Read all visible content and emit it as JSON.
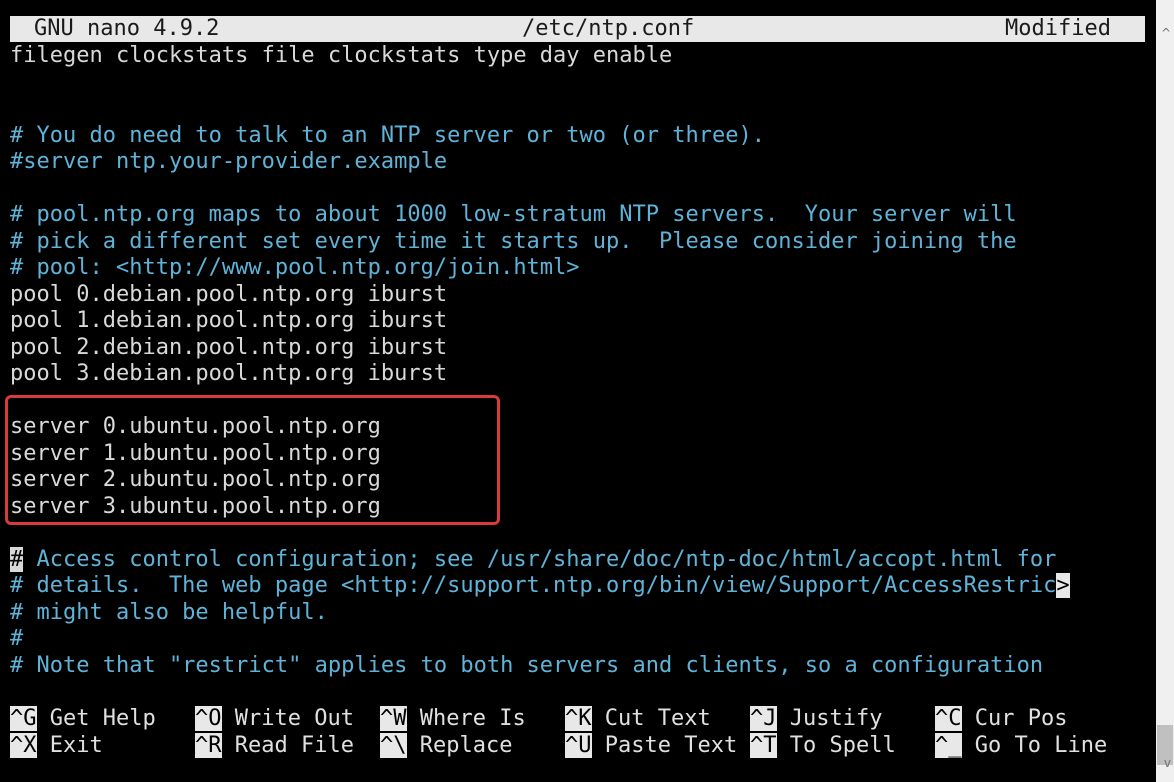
{
  "titlebar": {
    "app": "GNU nano 4.9.2",
    "file": "/etc/ntp.conf",
    "status": "Modified"
  },
  "lines": [
    {
      "text": "filegen clockstats file clockstats type day enable",
      "kind": "plain"
    },
    {
      "text": "",
      "kind": "plain"
    },
    {
      "text": "",
      "kind": "plain"
    },
    {
      "text": "# You do need to talk to an NTP server or two (or three).",
      "kind": "comment"
    },
    {
      "text": "#server ntp.your-provider.example",
      "kind": "comment"
    },
    {
      "text": "",
      "kind": "plain"
    },
    {
      "text": "# pool.ntp.org maps to about 1000 low-stratum NTP servers.  Your server will",
      "kind": "comment"
    },
    {
      "text": "# pick a different set every time it starts up.  Please consider joining the",
      "kind": "comment"
    },
    {
      "text": "# pool: <http://www.pool.ntp.org/join.html>",
      "kind": "comment"
    },
    {
      "text": "pool 0.debian.pool.ntp.org iburst",
      "kind": "plain"
    },
    {
      "text": "pool 1.debian.pool.ntp.org iburst",
      "kind": "plain"
    },
    {
      "text": "pool 2.debian.pool.ntp.org iburst",
      "kind": "plain"
    },
    {
      "text": "pool 3.debian.pool.ntp.org iburst",
      "kind": "plain"
    },
    {
      "text": "",
      "kind": "plain"
    },
    {
      "text": "server 0.ubuntu.pool.ntp.org",
      "kind": "plain"
    },
    {
      "text": "server 1.ubuntu.pool.ntp.org",
      "kind": "plain"
    },
    {
      "text": "server 2.ubuntu.pool.ntp.org",
      "kind": "plain"
    },
    {
      "text": "server 3.ubuntu.pool.ntp.org",
      "kind": "plain"
    },
    {
      "text": "",
      "kind": "plain"
    },
    {
      "text": " Access control configuration; see /usr/share/doc/ntp-doc/html/accopt.html for",
      "kind": "comment"
    },
    {
      "text": "# details.  The web page <http://support.ntp.org/bin/view/Support/AccessRestric",
      "kind": "comment"
    },
    {
      "text": "# might also be helpful.",
      "kind": "comment"
    },
    {
      "text": "#",
      "kind": "comment"
    },
    {
      "text": "# Note that \"restrict\" applies to both servers and clients, so a configuration",
      "kind": "comment"
    }
  ],
  "cursor_char": "#",
  "overflow_char": ">",
  "shortcuts_row1": [
    {
      "key": "^G",
      "label": "Get Help"
    },
    {
      "key": "^O",
      "label": "Write Out"
    },
    {
      "key": "^W",
      "label": "Where Is"
    },
    {
      "key": "^K",
      "label": "Cut Text"
    },
    {
      "key": "^J",
      "label": "Justify"
    },
    {
      "key": "^C",
      "label": "Cur Pos"
    }
  ],
  "shortcuts_row2": [
    {
      "key": "^X",
      "label": "Exit"
    },
    {
      "key": "^R",
      "label": "Read File"
    },
    {
      "key": "^\\",
      "label": "Replace"
    },
    {
      "key": "^U",
      "label": "Paste Text"
    },
    {
      "key": "^T",
      "label": "To Spell"
    },
    {
      "key": "^_",
      "label": "Go To Line"
    }
  ],
  "colors": {
    "background": "#000000",
    "comment": "#5fb3d8",
    "text": "#d9d9d9",
    "titlebar_bg": "#e8e8e8",
    "highlight_border": "#d93a3a"
  }
}
